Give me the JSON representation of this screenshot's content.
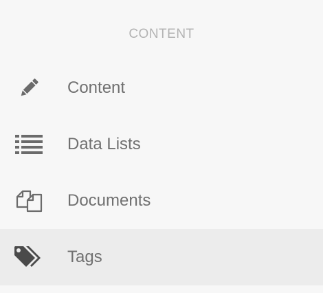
{
  "section": {
    "title": "CONTENT"
  },
  "menu": {
    "items": [
      {
        "label": "Content",
        "icon": "pencil-icon",
        "active": false
      },
      {
        "label": "Data Lists",
        "icon": "list-icon",
        "active": false
      },
      {
        "label": "Documents",
        "icon": "documents-icon",
        "active": false
      },
      {
        "label": "Tags",
        "icon": "tags-icon",
        "active": true
      }
    ]
  },
  "colors": {
    "background": "#f7f7f7",
    "active_background": "#ececec",
    "title": "#b3b3b3",
    "label": "#707070",
    "icon": "#6b6b6b",
    "icon_active": "#4a4a4a"
  }
}
